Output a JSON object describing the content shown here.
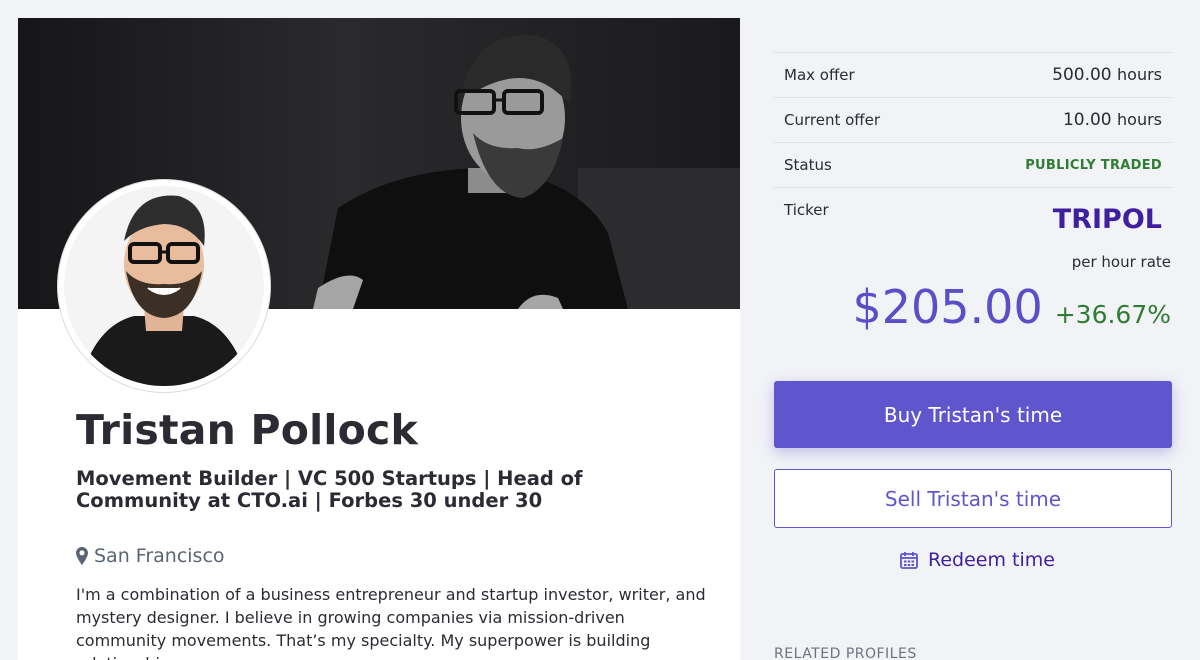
{
  "profile": {
    "name": "Tristan Pollock",
    "headline": "Movement Builder | VC 500 Startups | Head of Community at CTO.ai | Forbes 30 under 30",
    "location": "San Francisco",
    "bio": "I'm a combination of a business entrepreneur and startup investor, writer, and mystery designer. I believe in growing companies via mission-driven community movements. That’s my specialty. My superpower is building relationships."
  },
  "stats": {
    "max_offer_label": "Max offer",
    "max_offer_value": "500.00",
    "max_offer_unit": "hours",
    "current_offer_label": "Current offer",
    "current_offer_value": "10.00",
    "current_offer_unit": "hours",
    "status_label": "Status",
    "status_value": "PUBLICLY TRADED",
    "ticker_label": "Ticker",
    "ticker_value": "TRIPOL"
  },
  "pricing": {
    "rate_label": "per hour rate",
    "price": "$205.00",
    "change": "+36.67%"
  },
  "actions": {
    "buy_label": "Buy Tristan's time",
    "sell_label": "Sell Tristan's time",
    "redeem_label": "Redeem time"
  },
  "related": {
    "heading": "RELATED PROFILES"
  },
  "colors": {
    "accent": "#5f55cd",
    "ticker": "#3f1fa0",
    "positive": "#2e7d32",
    "background": "#f2f3f7"
  },
  "icons": {
    "location": "map-marker-icon",
    "redeem": "calendar-icon"
  }
}
